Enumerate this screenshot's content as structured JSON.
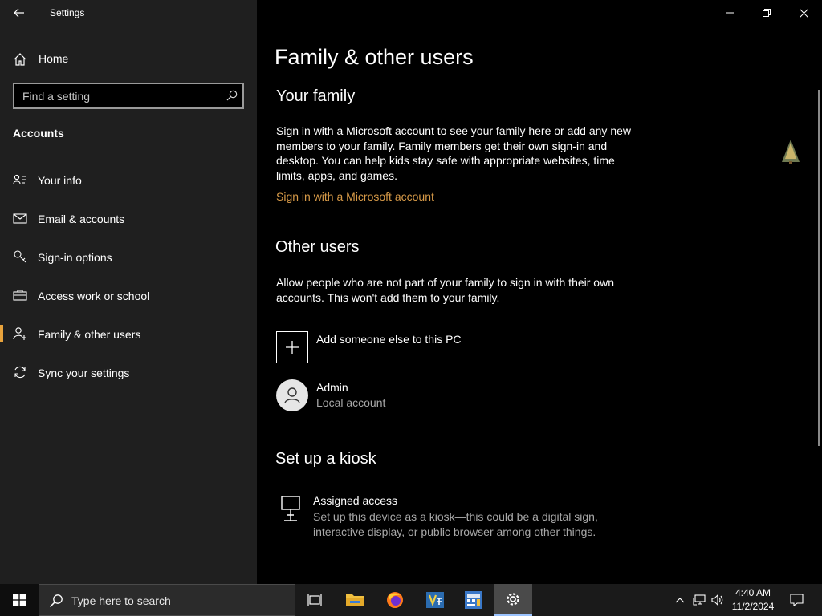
{
  "window": {
    "title": "Settings"
  },
  "sidebar": {
    "home_label": "Home",
    "search_placeholder": "Find a setting",
    "section_label": "Accounts",
    "items": [
      {
        "label": "Your info",
        "icon": "person-card-icon",
        "active": false
      },
      {
        "label": "Email & accounts",
        "icon": "mail-icon",
        "active": false
      },
      {
        "label": "Sign-in options",
        "icon": "key-icon",
        "active": false
      },
      {
        "label": "Access work or school",
        "icon": "briefcase-icon",
        "active": false
      },
      {
        "label": "Family & other users",
        "icon": "person-add-icon",
        "active": true
      },
      {
        "label": "Sync your settings",
        "icon": "sync-icon",
        "active": false
      }
    ],
    "accent_color": "#e8a33c"
  },
  "main": {
    "page_title": "Family & other users",
    "family": {
      "heading": "Your family",
      "paragraph": "Sign in with a Microsoft account to see your family here or add any new members to your family. Family members get their own sign-in and desktop. You can help kids stay safe with appropriate websites, time limits, apps, and games.",
      "link": "Sign in with a Microsoft account"
    },
    "other_users": {
      "heading": "Other users",
      "paragraph": "Allow people who are not part of your family to sign in with their own accounts. This won't add them to your family.",
      "add_label": "Add someone else to this PC",
      "users": [
        {
          "name": "Admin",
          "type": "Local account"
        }
      ]
    },
    "kiosk": {
      "heading": "Set up a kiosk",
      "item_title": "Assigned access",
      "item_desc": "Set up this device as a kiosk—this could be a digital sign, interactive display, or public browser among other things."
    },
    "link_color": "#d79a48"
  },
  "taskbar": {
    "search_placeholder": "Type here to search",
    "apps": [
      {
        "name": "task-view-icon"
      },
      {
        "name": "file-explorer-icon"
      },
      {
        "name": "firefox-icon"
      },
      {
        "name": "visual-studio-icon"
      },
      {
        "name": "calculator-app-icon"
      },
      {
        "name": "settings-icon",
        "active": true
      }
    ],
    "time": "4:40 AM",
    "date": "11/2/2024"
  }
}
